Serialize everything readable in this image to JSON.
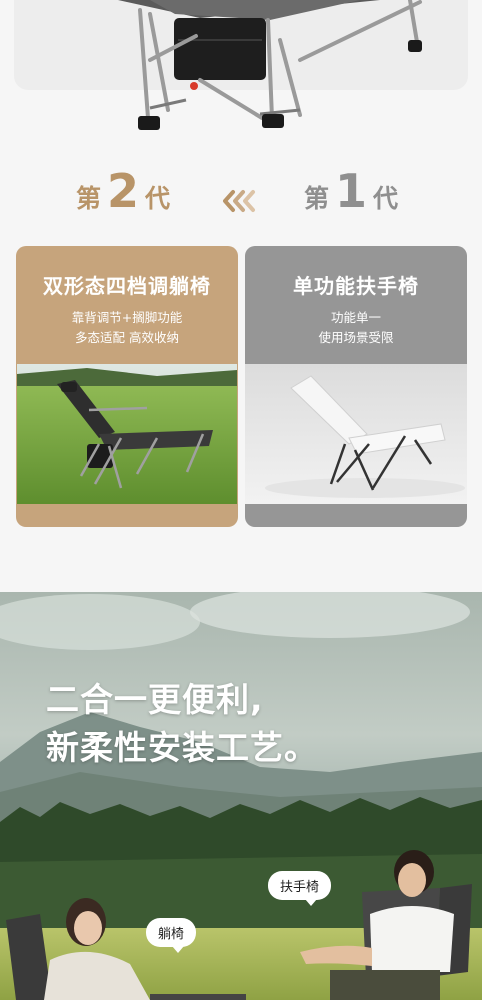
{
  "comparison": {
    "new_gen": {
      "prefix": "第",
      "number": "2",
      "suffix": "代"
    },
    "old_gen": {
      "prefix": "第",
      "number": "1",
      "suffix": "代"
    },
    "arrow_icon": "triple-chevron-left-icon",
    "colors": {
      "new": "#b89468",
      "old": "#8f8f8f"
    }
  },
  "cards": {
    "new": {
      "title": "双形态四档调躺椅",
      "desc": [
        "靠背调节+搁脚功能",
        "多态适配  高效收纳"
      ],
      "bg": "#c6a47c"
    },
    "old": {
      "title": "单功能扶手椅",
      "desc": [
        "功能单一",
        "使用场景受限"
      ],
      "bg": "#969696"
    }
  },
  "banner": {
    "headline": [
      "二合一更便利,",
      "新柔性安装工艺。"
    ],
    "bubble_recliner": "躺椅",
    "bubble_armchair": "扶手椅"
  }
}
